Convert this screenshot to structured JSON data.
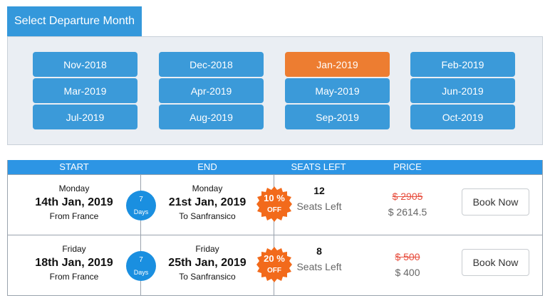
{
  "header": {
    "title": "Select Departure Month"
  },
  "months": {
    "selected": "Jan-2019",
    "items": [
      "Nov-2018",
      "Dec-2018",
      "Jan-2019",
      "Feb-2019",
      "Mar-2019",
      "Apr-2019",
      "May-2019",
      "Jun-2019",
      "Jul-2019",
      "Aug-2019",
      "Sep-2019",
      "Oct-2019"
    ]
  },
  "table": {
    "headers": {
      "start": "START",
      "end": "END",
      "seats": "SEATS LEFT",
      "price": "PRICE"
    },
    "rows": [
      {
        "start_day": "Monday",
        "start_date": "14th Jan, 2019",
        "from": "From France",
        "days_num": "7",
        "days_label": "Days",
        "end_day": "Monday",
        "end_date": "21st Jan, 2019",
        "to": "To Sanfransico",
        "discount_pct": "10 %",
        "discount_off": "OFF",
        "seats_num": "12",
        "seats_label": "Seats Left",
        "old_price": "$ 2905",
        "new_price": "$ 2614.5",
        "book_label": "Book Now"
      },
      {
        "start_day": "Friday",
        "start_date": "18th Jan, 2019",
        "from": "From France",
        "days_num": "7",
        "days_label": "Days",
        "end_day": "Friday",
        "end_date": "25th Jan, 2019",
        "to": "To Sanfransico",
        "discount_pct": "20 %",
        "discount_off": "OFF",
        "seats_num": "8",
        "seats_label": "Seats Left",
        "old_price": "$ 500",
        "new_price": "$ 400",
        "book_label": "Book Now"
      }
    ]
  },
  "colors": {
    "primary": "#3b9ad9",
    "active": "#ed7d31",
    "header_bar": "#2d95e4",
    "days_badge": "#1a8fe0",
    "discount_badge": "#f26a1b",
    "strike_price": "#e74c3c"
  }
}
